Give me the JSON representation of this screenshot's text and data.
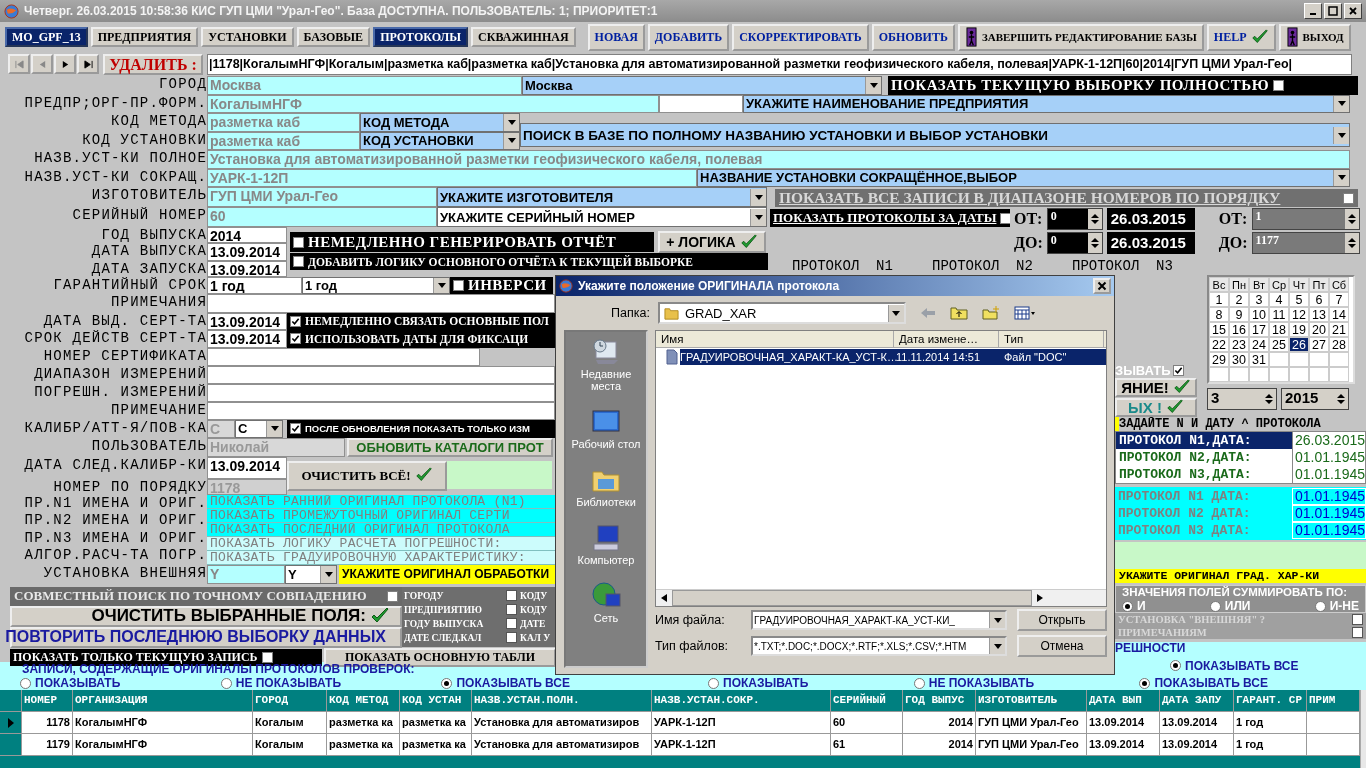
{
  "window": {
    "title": "Четверг. 26.03.2015 10:58:36 КИС ГУП ЦМИ \"Урал-Гео\". База ДОСТУПНА. ПОЛЬЗОВАТЕЛЬ: 1; ПРИОРИТЕТ:1"
  },
  "tabs": [
    {
      "label": "MO_GPF_13",
      "selected": true
    },
    {
      "label": "ПРЕДПРИЯТИЯ",
      "selected": false
    },
    {
      "label": "УСТАНОВКИ",
      "selected": false
    },
    {
      "label": "БАЗОВЫЕ",
      "selected": false
    },
    {
      "label": "ПРОТОКОЛЫ",
      "selected": true
    },
    {
      "label": "СКВАЖИННАЯ",
      "selected": false
    }
  ],
  "toolbar": [
    {
      "label": "НОВАЯ",
      "kind": "text"
    },
    {
      "label": "ДОБАВИТЬ",
      "kind": "text"
    },
    {
      "label": "СКОРРЕКТИРОВАТЬ",
      "kind": "text"
    },
    {
      "label": "ОБНОВИТЬ",
      "kind": "text"
    },
    {
      "label": "ЗАВЕРШИТЬ РЕДАКТИРОВАНИЕ БАЗЫ",
      "kind": "door"
    },
    {
      "label": "HELP",
      "kind": "check"
    },
    {
      "label": "ВЫХОД",
      "kind": "door"
    }
  ],
  "navigator": {
    "buttons": [
      {
        "kind": "first",
        "disabled": true
      },
      {
        "kind": "prev",
        "disabled": true
      },
      {
        "kind": "next",
        "disabled": false
      },
      {
        "kind": "last",
        "disabled": false
      }
    ],
    "delete_label": "УДАЛИТЬ :",
    "record": "|1178|КогалымНГФ|Когалым|разметка каб|разметка каб|Установка для автоматизированной разметки геофизического кабеля, полевая|УАРК-1-12П|60|2014|ГУП ЦМИ Урал-Гео|"
  },
  "form": {
    "city": {
      "label": "ГОРОД",
      "value": "Москва",
      "combo": "Москва"
    },
    "enterprise": {
      "label": "ПРЕДПР;ОРГ-ПР.ФОРМ.",
      "value": "КогалымНГФ",
      "combo": "УКАЖИТЕ НАИМЕНОВАНИЕ ПРЕДПРИЯТИЯ"
    },
    "method": {
      "label": "КОД МЕТОДА",
      "value": "разметка каб",
      "combo": "КОД МЕТОДА"
    },
    "unit_code": {
      "label": "КОД УСТАНОВКИ",
      "value": "разметка каб",
      "combo": "КОД УСТАНОВКИ"
    },
    "search_combo": "ПОИСК В БАЗЕ ПО ПОЛНОМУ НАЗВАНИЮ УСТАНОВКИ И ВЫБОР УСТАНОВКИ",
    "full_name": {
      "label": "НАЗВ.УСТ-КИ ПОЛНОЕ",
      "value": "Установка для автоматизированной разметки геофизического кабеля, полевая"
    },
    "short_name": {
      "label": "НАЗВ.УСТ-КИ СОКРАЩ.",
      "value": "УАРК-1-12П",
      "combo": "НАЗВАНИЕ УСТАНОВКИ СОКРАЩЁННОЕ,ВЫБОР"
    },
    "maker": {
      "label": "ИЗГОТОВИТЕЛЬ",
      "value": "ГУП ЦМИ Урал-Гео",
      "combo": "УКАЖИТЕ ИЗГОТОВИТЕЛЯ"
    },
    "serial": {
      "label": "СЕРИЙНЫЙ НОМЕР",
      "value": "60",
      "combo": "УКАЖИТЕ СЕРИЙНЫЙ НОМЕР"
    },
    "year": {
      "label": "ГОД ВЫПУСКА",
      "value": "2014"
    },
    "release_date": {
      "label": "ДАТА ВЫПУСКА",
      "value": "13.09.2014"
    },
    "start_date": {
      "label": "ДАТА ЗАПУСКА",
      "value": "13.09.2014"
    },
    "warranty": {
      "label": "ГАРАНТИЙНЫЙ СРОК",
      "value": "1 год",
      "combo": "1 год"
    },
    "notes": {
      "label": "ПРИМЕЧАНИЯ"
    },
    "cert_date": {
      "label": "ДАТА ВЫД. СЕРТ-ТА",
      "value": "13.09.2014"
    },
    "cert_valid": {
      "label": "СРОК ДЕЙСТВ СЕРТ-ТА",
      "value": "13.09.2014"
    },
    "cert_number": {
      "label": "НОМЕР СЕРТИФИКАТА"
    },
    "range": {
      "label": "ДИАПАЗОН ИЗМЕРЕНИЙ"
    },
    "error": {
      "label": "ПОГРЕШН. ИЗМЕРЕНИЙ"
    },
    "note": {
      "label": "ПРИМЕЧАНИЕ"
    },
    "calib": {
      "label": "КАЛИБР/АТТ-Я/ПОВ-КА",
      "value": "С",
      "combo": "С"
    },
    "user": {
      "label": "ПОЛЬЗОВАТЕЛЬ",
      "value": "Николай"
    },
    "next_calib": {
      "label": "ДАТА СЛЕД.КАЛИБР-КИ",
      "value": "13.09.2014"
    },
    "order_number": {
      "label": "НОМЕР ПО ПОРЯДКУ",
      "value": "1178"
    },
    "orig_labels": [
      "ПР.N1 ИМЕНА И ОРИГ.",
      "ПР.N2 ИМЕНА И ОРИГ.",
      "ПР.N3 ИМЕНА И ОРИГ.",
      "АЛГОР.РАСЧ-ТА ПОГР."
    ],
    "external": {
      "label": "УСТАНОВКА ВНЕШНЯЯ",
      "value": "Y",
      "combo": "Y"
    }
  },
  "options": {
    "show_current": {
      "label": "ПОКАЗАТЬ ТЕКУЩУЮ ВЫБОРКУ ПОЛНОСТЬЮ",
      "checked": false
    },
    "generate_report": {
      "label": "НЕМЕДЛЕННО ГЕНЕРИРОВАТЬ ОТЧЁТ",
      "checked": false
    },
    "logic_button": "+ ЛОГИКА",
    "add_logic": {
      "label": "ДОБАВИТЬ ЛОГИКУ ОСНОВНОГО ОТЧЁТА К ТЕКУЩЕЙ ВЫБОРКЕ",
      "checked": false
    },
    "inversion": {
      "label": "ИНВЕРСИ",
      "checked": false
    },
    "link_fields": {
      "label": "НЕМЕДЛЕННО СВЯЗАТЬ ОСНОВНЫЕ ПОЛ",
      "checked": true
    },
    "use_dates": {
      "label": "ИСПОЛЬЗОВАТЬ ДАТЫ ДЛЯ ФИКСАЦИ",
      "checked": true
    },
    "after_update": {
      "label": "ПОСЛЕ ОБНОВЛЕНИЯ ПОКАЗАТЬ ТОЛЬКО ИЗМ",
      "checked": true
    },
    "refresh_catalogs": "ОБНОВИТЬ КАТАЛОГИ ПРОТ",
    "clear_all": "ОЧИСТИТЬ ВСЁ!",
    "original_links": [
      {
        "label": "ПОКАЗАТЬ РАННИЙ ОРИГИНАЛ ПРОТОКОЛА (N1)",
        "kind": "strong"
      },
      {
        "label": "ПОКАЗАТЬ ПРОМЕЖУТОЧНЫЙ ОРИГИНАЛ СЕРТИ",
        "kind": "strong"
      },
      {
        "label": "ПОКАЗАТЬ ПОСЛЕДНИЙ ОРИГИНАЛ ПРОТОКОЛА",
        "kind": "strong"
      },
      {
        "label": "ПОКАЗАТЬ ЛОГИКУ РАСЧЕТА ПОГРЕШНОСТИ:",
        "kind": "light"
      },
      {
        "label": "ПОКАЗАТЬ ГРАДУИРОВОЧНУЮ ХАРАКТЕРИСТИКУ:",
        "kind": "light"
      }
    ],
    "process_original": "УКАЖИТЕ ОРИГИНАЛ ОБРАБОТКИ",
    "joint_search": {
      "label": "СОВМЕСТНЫЙ ПОИСК ПО ТОЧНОМУ СОВПАДЕНИЮ",
      "checked": false
    },
    "search_fields": [
      {
        "label": "ГОРОДУ",
        "checked": false
      },
      {
        "label": "ПРЕДПРИЯТИЮ",
        "checked": false
      },
      {
        "label": "ГОДУ ВЫПУСКА",
        "checked": false
      },
      {
        "label": "ДАТЕ СЛЕД.КАЛ",
        "checked": false
      }
    ],
    "search_fields_2": [
      "КОДУ",
      "КОДУ",
      "ДАТЕ",
      "КАЛ У"
    ],
    "clear_selected": "ОЧИСТИТЬ ВЫБРАННЫЕ ПОЛЯ:",
    "repeat_last": "ПОВТОРИТЬ ПОСЛЕДНЮЮ ВЫБОРКУ ДАННЫХ",
    "current_only": {
      "label": "ПОКАЗАТЬ ТОЛЬКО ТЕКУЩУЮ ЗАПИСЬ",
      "checked": false
    },
    "show_main_table": "ПОКАЗАТЬ ОСНОВНУЮ ТАБЛИ"
  },
  "filters": {
    "range_filter": {
      "label": "ПОКАЗАТЬ ВСЕ ЗАПИСИ В ДИАПАЗОНЕ НОМЕРОВ ПО ПОРЯДКУ",
      "checked": false
    },
    "date_filter": {
      "label": "ПОКАЗАТЬ ПРОТОКОЛЫ ЗА ДАТЫ",
      "checked": false,
      "from_label": "ОТ:",
      "to_label": "ДО:",
      "from_n": "0",
      "to_n": "0",
      "from_date": "26.03.2015",
      "to_date": "26.03.2015"
    },
    "number_range": {
      "from_label": "ОТ:",
      "to_label": "ДО:",
      "from": "1",
      "to": "1177"
    },
    "protocol_headers": [
      "ПРОТОКОЛ  N1",
      "ПРОТОКОЛ  N2",
      "ПРОТОКОЛ  N3"
    ]
  },
  "panel": {
    "partial_checkbox": {
      "label": "ЗЫВАТЬ",
      "checked": true
    },
    "partial_buttons": [
      "ЯНИЕ!",
      "ЫХ  !"
    ],
    "calendar": {
      "weekdays": [
        "Вс",
        "Пн",
        "Вт",
        "Ср",
        "Чт",
        "Пт",
        "Сб"
      ],
      "days": [
        {
          "day": "1",
          "selected": false
        },
        {
          "day": "2",
          "selected": false
        },
        {
          "day": "3",
          "selected": false
        },
        {
          "day": "4",
          "selected": false
        },
        {
          "day": "5",
          "selected": false
        },
        {
          "day": "6",
          "selected": false
        },
        {
          "day": "7",
          "selected": false
        },
        {
          "day": "8",
          "selected": false
        },
        {
          "day": "9",
          "selected": false
        },
        {
          "day": "10",
          "selected": false
        },
        {
          "day": "11",
          "selected": false
        },
        {
          "day": "12",
          "selected": false
        },
        {
          "day": "13",
          "selected": false
        },
        {
          "day": "14",
          "selected": false
        },
        {
          "day": "15",
          "selected": false
        },
        {
          "day": "16",
          "selected": false
        },
        {
          "day": "17",
          "selected": false
        },
        {
          "day": "18",
          "selected": false
        },
        {
          "day": "19",
          "selected": false
        },
        {
          "day": "20",
          "selected": false
        },
        {
          "day": "21",
          "selected": false
        },
        {
          "day": "22",
          "selected": false
        },
        {
          "day": "23",
          "selected": false
        },
        {
          "day": "24",
          "selected": false
        },
        {
          "day": "25",
          "selected": false
        },
        {
          "day": "26",
          "selected": true
        },
        {
          "day": "27",
          "selected": false
        },
        {
          "day": "28",
          "selected": false
        },
        {
          "day": "29",
          "selected": false
        },
        {
          "day": "30",
          "selected": false
        },
        {
          "day": "31",
          "selected": false
        }
      ],
      "month": "3",
      "year": "2015"
    },
    "protocol_dates": {
      "title": "ЗАДАЙТЕ N И ДАТУ ^ ПРОТОКОЛА",
      "rows": [
        {
          "label": "ПРОТОКОЛ N1,ДАТА:",
          "date": "26.03.2015",
          "selected": true
        },
        {
          "label": "ПРОТОКОЛ N2,ДАТА:",
          "date": "01.01.1945",
          "selected": false
        },
        {
          "label": "ПРОТОКОЛ N3,ДАТА:",
          "date": "01.01.1945",
          "selected": false
        }
      ]
    },
    "original_dates": [
      {
        "label": "ПРОТОКОЛ N1 ДАТА:",
        "date": "01.01.1945"
      },
      {
        "label": "ПРОТОКОЛ N2 ДАТА:",
        "date": "01.01.1945"
      },
      {
        "label": "ПРОТОКОЛ N3 ДАТА:",
        "date": "01.01.1945"
      }
    ],
    "grad_original": "УКАЖИТЕ ОРИГИНАЛ ГРАД. ХАР-КИ",
    "sum_mode": {
      "title": "ЗНАЧЕНИЯ ПОЛЕЙ СУММИРОВАТЬ ПО:",
      "options": [
        {
          "label": "И",
          "selected": true
        },
        {
          "label": "ИЛИ",
          "selected": false
        },
        {
          "label": "И-НЕ",
          "selected": false
        }
      ]
    },
    "extra_checks": [
      {
        "label": "УСТАНОВКА \"ВНЕШНЯЯ\" ?",
        "checked": false
      },
      {
        "label": "ПРИМЕЧАНИЯМ",
        "checked": false
      }
    ],
    "error_group": {
      "title": "РЕШНОСТИ",
      "options": [
        {
          "label": "ПОКАЗЫВАТЬ ВСЕ",
          "selected": true
        }
      ]
    }
  },
  "records_filter": {
    "title": "ЗАПИСИ, СОДЕРЖАЩИЕ ОРИГИНАЛЫ ПРОТОКОЛОВ ПРОВЕРОК:",
    "groups": [
      {
        "options": [
          {
            "label": "ПОКАЗЫВАТЬ",
            "selected": false
          },
          {
            "label": "НЕ ПОКАЗЫВАТЬ",
            "selected": false
          },
          {
            "label": "ПОКАЗЫВАТЬ ВСЕ",
            "selected": true
          }
        ]
      },
      {
        "options": [
          {
            "label": "ПОКАЗЫВАТЬ",
            "selected": false
          },
          {
            "label": "НЕ ПОКАЗЫВАТЬ",
            "selected": false
          },
          {
            "label": "ПОКАЗЫВАТЬ ВСЕ",
            "selected": true
          }
        ]
      }
    ]
  },
  "table": {
    "columns": [
      "НОМЕР",
      "ОРГАНИЗАЦИЯ",
      "ГОРОД",
      "КОД МЕТОД",
      "КОД УСТАН",
      "НАЗВ.УСТАН.ПОЛН.",
      "НАЗВ.УСТАН.СОКР.",
      "СЕРИЙНЫЙ",
      "ГОД ВЫПУС",
      "ИЗГОТОВИТЕЛЬ",
      "ДАТА ВЫП",
      "ДАТА ЗАПУ",
      "ГАРАНТ. СР",
      "ПРИМ"
    ],
    "rows": [
      {
        "selected": true,
        "cells": [
          "1178",
          "КогалымНГФ",
          "Когалым",
          "разметка ка",
          "разметка ка",
          "Установка для автоматизиров",
          "УАРК-1-12П",
          "60",
          "2014",
          "ГУП ЦМИ Урал-Гео",
          "13.09.2014",
          "13.09.2014",
          "1 год"
        ]
      },
      {
        "selected": false,
        "cells": [
          "1179",
          "КогалымНГФ",
          "Когалым",
          "разметка ка",
          "разметка ка",
          "Установка для автоматизиров",
          "УАРК-1-12П",
          "61",
          "2014",
          "ГУП ЦМИ Урал-Гео",
          "13.09.2014",
          "13.09.2014",
          "1 год"
        ]
      }
    ]
  },
  "dialog": {
    "title": "Укажите положение ОРИГИНАЛА протокола",
    "folder_label": "Папка:",
    "folder": "GRAD_XAR",
    "places": [
      {
        "label": "Недавние места",
        "kind": "recent"
      },
      {
        "label": "Рабочий стол",
        "kind": "desktop"
      },
      {
        "label": "Библиотеки",
        "kind": "libraries"
      },
      {
        "label": "Компьютер",
        "kind": "computer"
      },
      {
        "label": "Сеть",
        "kind": "network"
      }
    ],
    "columns": [
      "Имя",
      "Дата измене…",
      "Тип"
    ],
    "files": [
      {
        "name": "ГРАДУИРОВОЧНАЯ_ХАРАКТ-КА_УСТ-К…",
        "date": "11.11.2014 14:51",
        "type": "Файл \"DOC\"",
        "selected": true
      }
    ],
    "filename_label": "Имя файла:",
    "filename": "ГРАДУИРОВОЧНАЯ_ХАРАКТ-КА_УСТ-КИ_",
    "filetype_label": "Тип файлов:",
    "filetype": "*.TXT;*.DOC;*.DOCX;*.RTF;*.XLS;*.CSV;*.HTM",
    "buttons": [
      "Открыть",
      "Отмена"
    ]
  }
}
